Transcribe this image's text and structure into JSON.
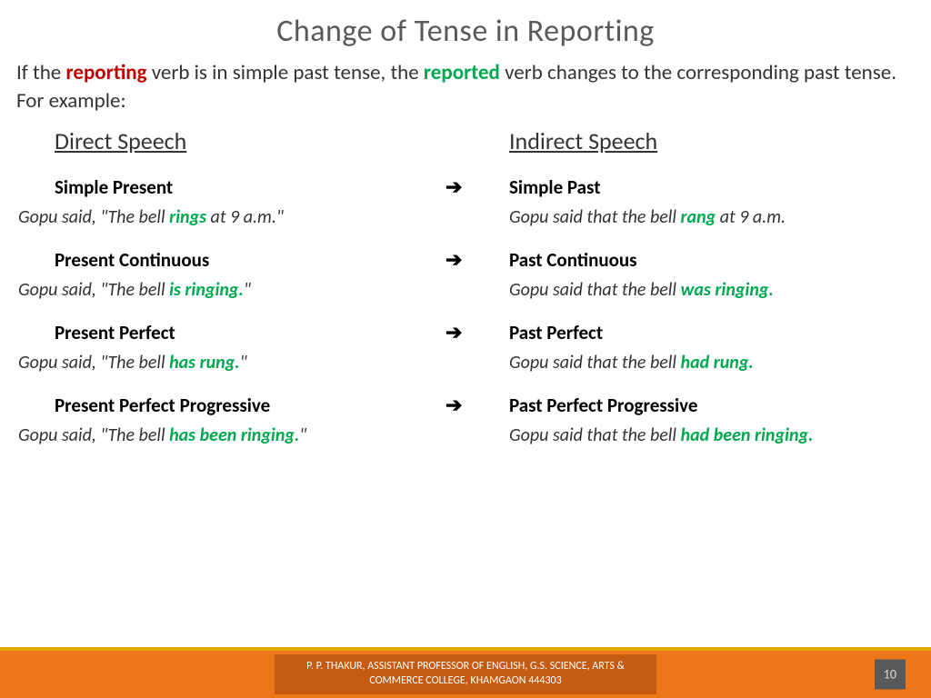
{
  "title": "Change of Tense in Reporting",
  "intro": {
    "pre": "If the ",
    "kw1": "reporting",
    "mid": " verb is in simple past tense, the ",
    "kw2": "reported",
    "post": " verb changes to the corresponding past tense. For example:"
  },
  "headers": {
    "left": "Direct Speech",
    "right": "Indirect Speech"
  },
  "arrow": "➔",
  "rows": [
    {
      "tense_left": "Simple Present",
      "ex_left_pre": "Gopu said, \"The bell ",
      "ex_left_verb": "rings",
      "ex_left_post": " at 9 a.m.\"",
      "tense_right": "Simple Past",
      "ex_right_pre": "Gopu said that the bell ",
      "ex_right_verb": "rang",
      "ex_right_post": " at 9 a.m."
    },
    {
      "tense_left": "Present Continuous",
      "ex_left_pre": "Gopu said, \"The bell ",
      "ex_left_verb": "is ringing.",
      "ex_left_post": "\"",
      "tense_right": "Past Continuous",
      "ex_right_pre": "Gopu said that the bell ",
      "ex_right_verb": "was ringing.",
      "ex_right_post": ""
    },
    {
      "tense_left": "Present Perfect",
      "ex_left_pre": "Gopu said, \"The bell ",
      "ex_left_verb": "has rung.",
      "ex_left_post": "\"",
      "tense_right": "Past Perfect",
      "ex_right_pre": "Gopu said that the bell ",
      "ex_right_verb": "had rung.",
      "ex_right_post": ""
    },
    {
      "tense_left": "Present Perfect Progressive",
      "ex_left_pre": "Gopu said, \"The bell ",
      "ex_left_verb": "has been ringing.",
      "ex_left_post": "\"",
      "tense_right": "Past Perfect Progressive",
      "ex_right_pre": "Gopu said that the bell ",
      "ex_right_verb": "had been ringing.",
      "ex_right_post": ""
    }
  ],
  "footer": {
    "line1": "P. P. THAKUR, ASSISTANT PROFESSOR OF ENGLISH, G.S. SCIENCE, ARTS &",
    "line2": "COMMERCE COLLEGE, KHAMGAON 444303",
    "page": "10"
  }
}
